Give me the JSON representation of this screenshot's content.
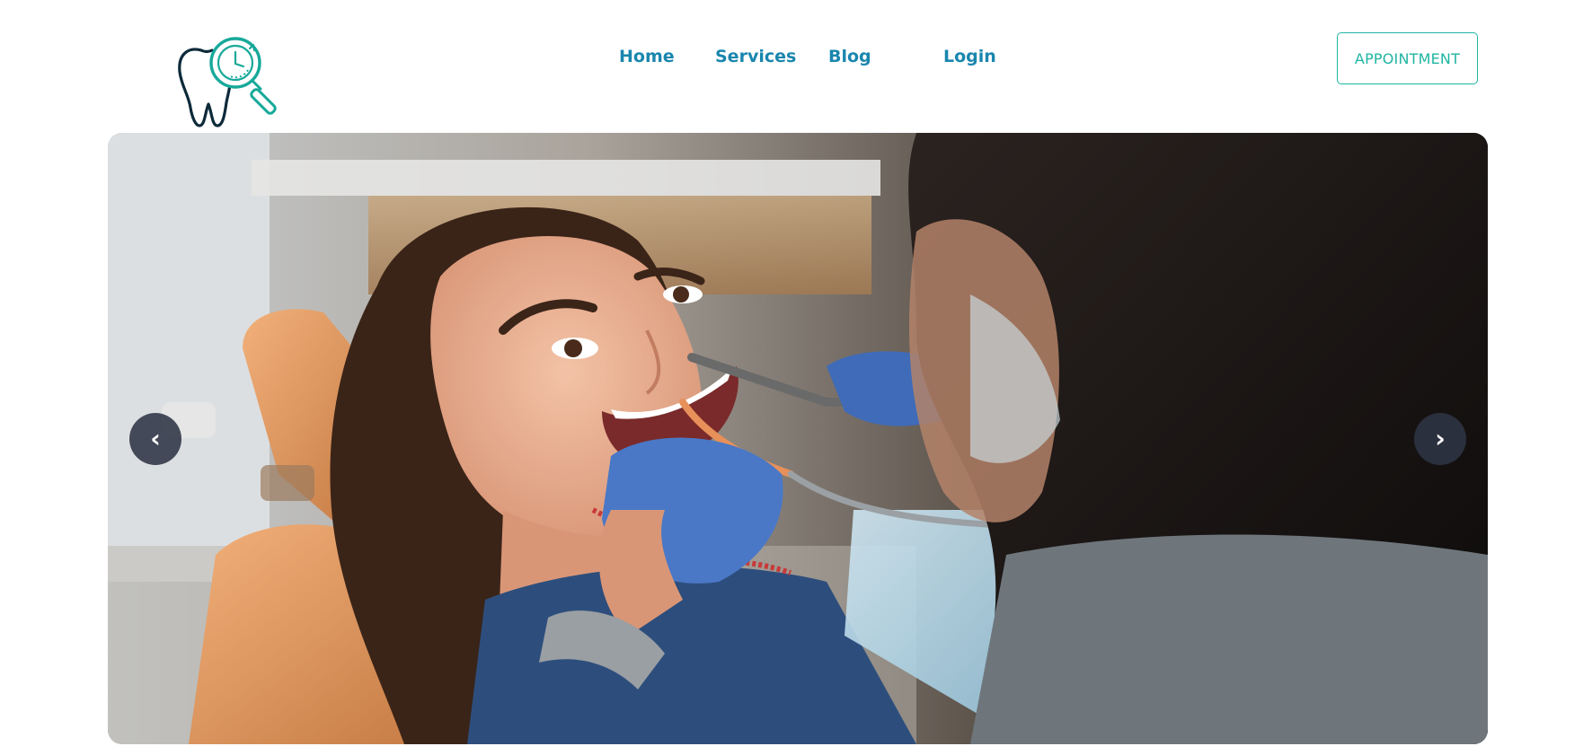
{
  "header": {
    "logo_icon": "tooth-magnifier-clock-logo",
    "nav": [
      {
        "label": "Home"
      },
      {
        "label": "Services"
      },
      {
        "label": "Blog"
      },
      {
        "label": "Login"
      }
    ],
    "appointment_label": "APPOINTMENT"
  },
  "hero": {
    "image": "dentist-treating-smiling-patient-photo",
    "prev_arrow": "‹",
    "next_arrow": "›"
  },
  "colors": {
    "nav_link": "#1a86ae",
    "accent": "#1fb5a2",
    "logo_dark": "#0d2a3a",
    "logo_teal": "#17a99a",
    "arrow_bg": "#2d3444"
  }
}
